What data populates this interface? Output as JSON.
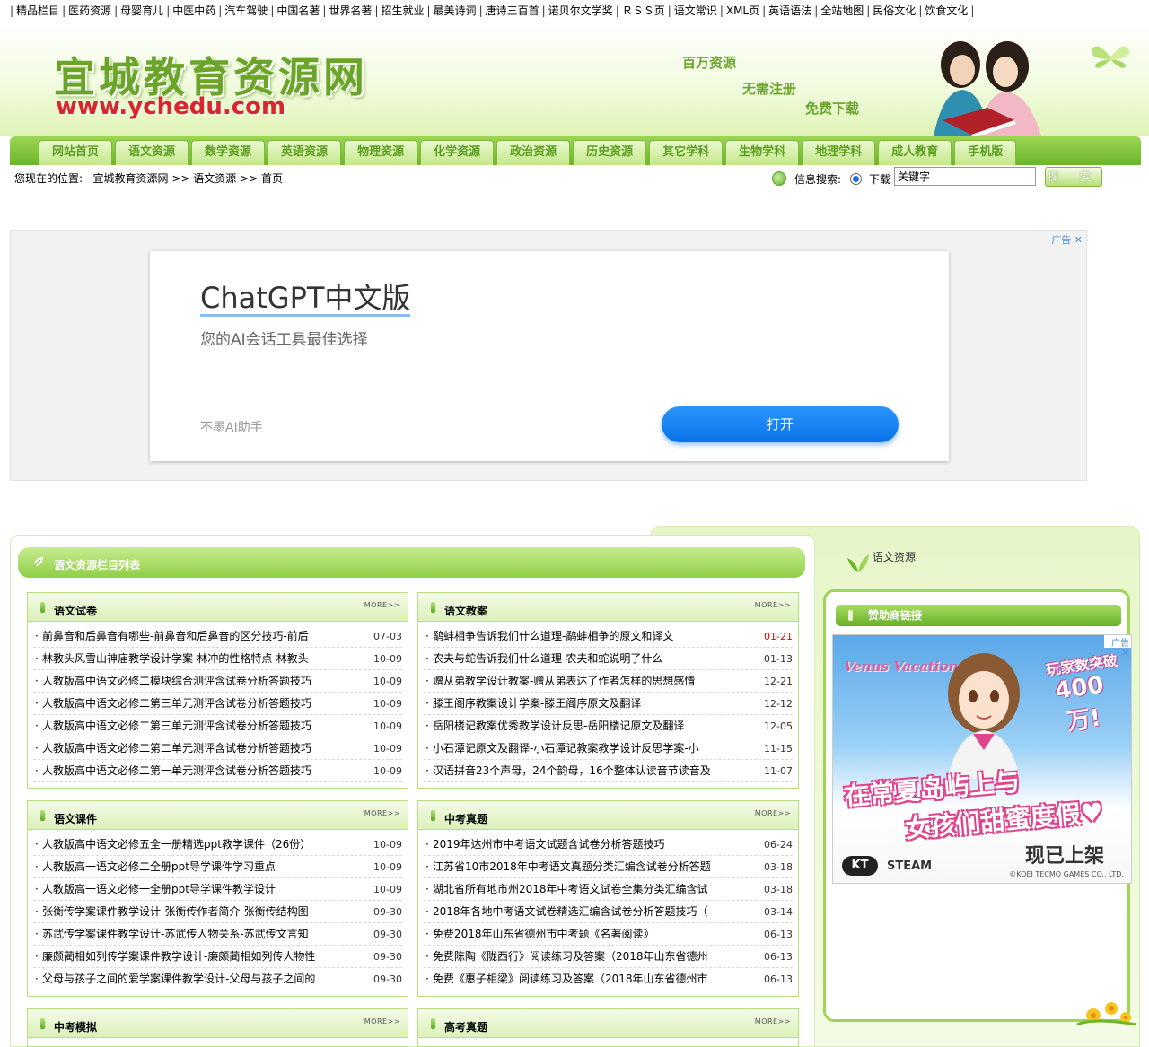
{
  "top_links": [
    "精品栏目",
    "医药资源",
    "母婴育儿",
    "中医中药",
    "汽车驾驶",
    "中国名著",
    "世界名著",
    "招生就业",
    "最美诗词",
    "唐诗三百首",
    "诺贝尔文学奖",
    "ＲＳＳ页",
    "语文常识",
    "XML页",
    "英语语法",
    "全站地图",
    "民俗文化",
    "饮食文化"
  ],
  "header": {
    "logo_cn": "宜城教育资源网",
    "logo_url": "www.ychedu.com",
    "slogans": [
      "百万资源",
      "无需注册",
      "免费下载"
    ]
  },
  "nav": [
    "网站首页",
    "语文资源",
    "数学资源",
    "英语资源",
    "物理资源",
    "化学资源",
    "政治资源",
    "历史资源",
    "其它学科",
    "生物学科",
    "地理学科",
    "成人教育",
    "手机版"
  ],
  "location": {
    "label": "您现在的位置:",
    "path": "宜城教育资源网 >> 语文资源 >> 首页"
  },
  "search": {
    "label": "信息搜索:",
    "radio_label": "下载",
    "value": "关键字",
    "button": "搜 索"
  },
  "ad": {
    "tag": "广告 ✕",
    "title": "ChatGPT中文版",
    "subtitle": "您的AI会话工具最佳选择",
    "brand": "不墨AI助手",
    "button": "打开"
  },
  "main": {
    "title": "语文资源栏目列表",
    "boxes": [
      {
        "title": "语文试卷",
        "more": "MORE>>",
        "items": [
          {
            "t": "前鼻音和后鼻音有哪些-前鼻音和后鼻音的区分技巧-前后",
            "d": "07-03",
            "red": false
          },
          {
            "t": "林教头风雪山神庙教学设计学案-林冲的性格特点-林教头",
            "d": "10-09",
            "red": false
          },
          {
            "t": "人教版高中语文必修二模块综合测评含试卷分析答题技巧",
            "d": "10-09",
            "red": false
          },
          {
            "t": "人教版高中语文必修二第三单元测评含试卷分析答题技巧",
            "d": "10-09",
            "red": false
          },
          {
            "t": "人教版高中语文必修二第三单元测评含试卷分析答题技巧",
            "d": "10-09",
            "red": false
          },
          {
            "t": "人教版高中语文必修二第二单元测评含试卷分析答题技巧",
            "d": "10-09",
            "red": false
          },
          {
            "t": "人教版高中语文必修二第一单元测评含试卷分析答题技巧",
            "d": "10-09",
            "red": false
          }
        ]
      },
      {
        "title": "语文教案",
        "more": "MORE>>",
        "items": [
          {
            "t": "鹬蚌相争告诉我们什么道理-鹬蚌相争的原文和译文",
            "d": "01-21",
            "red": true
          },
          {
            "t": "农夫与蛇告诉我们什么道理-农夫和蛇说明了什么",
            "d": "01-13",
            "red": false
          },
          {
            "t": "赠从弟教学设计教案-赠从弟表达了作者怎样的思想感情",
            "d": "12-21",
            "red": false
          },
          {
            "t": "滕王阁序教案设计学案-滕王阁序原文及翻译",
            "d": "12-12",
            "red": false
          },
          {
            "t": "岳阳楼记教案优秀教学设计反思-岳阳楼记原文及翻译",
            "d": "12-05",
            "red": false
          },
          {
            "t": "小石潭记原文及翻译-小石潭记教案教学设计反思学案-小",
            "d": "11-15",
            "red": false
          },
          {
            "t": "汉语拼音23个声母，24个韵母，16个整体认读音节读音及",
            "d": "11-07",
            "red": false
          }
        ]
      },
      {
        "title": "语文课件",
        "more": "MORE>>",
        "items": [
          {
            "t": "人教版高中语文必修五全一册精选ppt教学课件（26份）",
            "d": "10-09",
            "red": false
          },
          {
            "t": "人教版高一语文必修二全册ppt导学课件学习重点",
            "d": "10-09",
            "red": false
          },
          {
            "t": "人教版高一语文必修一全册ppt导学课件教学设计",
            "d": "10-09",
            "red": false
          },
          {
            "t": "张衡传学案课件教学设计-张衡传作者简介-张衡传结构图",
            "d": "09-30",
            "red": false
          },
          {
            "t": "苏武传学案课件教学设计-苏武传人物关系-苏武传文言知",
            "d": "09-30",
            "red": false
          },
          {
            "t": "廉颇蔺相如列传学案课件教学设计-廉颇蔺相如列传人物性",
            "d": "09-30",
            "red": false
          },
          {
            "t": "父母与孩子之间的爱学案课件教学设计-父母与孩子之间的",
            "d": "09-30",
            "red": false
          }
        ]
      },
      {
        "title": "中考真题",
        "more": "MORE>>",
        "items": [
          {
            "t": "2019年达州市中考语文试题含试卷分析答题技巧",
            "d": "06-24",
            "red": false
          },
          {
            "t": "江苏省10市2018年中考语文真题分类汇编含试卷分析答题",
            "d": "03-18",
            "red": false
          },
          {
            "t": "湖北省所有地市州2018年中考语文试卷全集分类汇编含试",
            "d": "03-18",
            "red": false
          },
          {
            "t": "2018年各地中考语文试卷精选汇编含试卷分析答题技巧（",
            "d": "03-14",
            "red": false
          },
          {
            "t": "免费2018年山东省德州市中考题《名著阅读》",
            "d": "06-13",
            "red": false
          },
          {
            "t": "免费陈陶《陇西行》阅读练习及答案（2018年山东省德州",
            "d": "06-13",
            "red": false
          },
          {
            "t": "免费《惠子相梁》阅读练习及答案（2018年山东省德州市",
            "d": "06-13",
            "red": false
          }
        ]
      },
      {
        "title": "中考模拟",
        "more": "MORE>>",
        "items": []
      },
      {
        "title": "高考真题",
        "more": "MORE>>",
        "items": []
      }
    ]
  },
  "sidebar": {
    "title": "语文资源",
    "sponsor_title": "赞助商链接",
    "game_ad": {
      "tag": "广告 ✕",
      "brand": "Venus Vacation",
      "badge_a": "玩家数突破",
      "badge_b": "400万!",
      "line1": "在常夏岛屿上与",
      "line2": "女孩们甜蜜度假♥",
      "release": "现已上架",
      "logo_kt": "KT",
      "logo_steam": "STEAM",
      "copyright": "©KOEI TECMO GAMES CO., LTD."
    }
  }
}
